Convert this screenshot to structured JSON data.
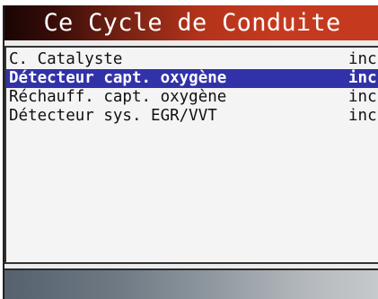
{
  "header": {
    "title": "Ce Cycle de Conduite"
  },
  "list": {
    "rows": [
      {
        "label": "C. Catalyste",
        "status": "inc",
        "selected": false
      },
      {
        "label": "Détecteur capt. oxygène",
        "status": "inc",
        "selected": true
      },
      {
        "label": "Réchauff. capt. oxygène",
        "status": "inc",
        "selected": false
      },
      {
        "label": "Détecteur sys. EGR/VVT",
        "status": "inc",
        "selected": false
      }
    ]
  },
  "colors": {
    "title_gradient_end": "#c53a1f",
    "selection_background": "#3232a8",
    "selection_text": "#ffffff"
  }
}
